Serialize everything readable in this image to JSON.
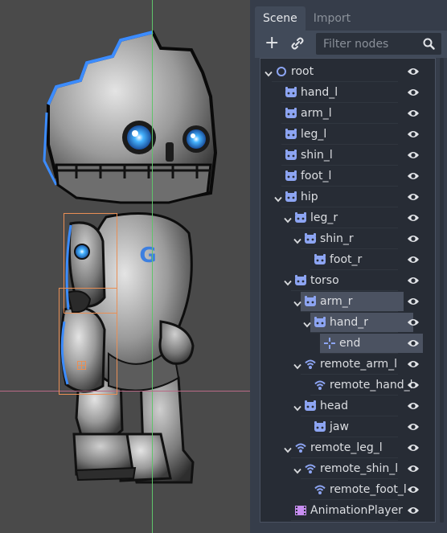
{
  "dock": {
    "tabs": [
      {
        "label": "Scene",
        "active": true
      },
      {
        "label": "Import",
        "active": false
      }
    ],
    "toolbar": {
      "add_icon": "plus-icon",
      "link_icon": "link-icon",
      "filter_placeholder": "Filter nodes",
      "search_icon": "search-icon"
    }
  },
  "colors": {
    "accent": "#8da5f3",
    "bone_outline": "#e98f55",
    "axis_vertical": "#5fc46a",
    "axis_horizontal": "#b86a86",
    "selection": "#4b5261"
  },
  "scene_tree": [
    {
      "label": "root",
      "depth": 0,
      "icon": "node2d-circle-icon",
      "arrow": "open",
      "selected": false
    },
    {
      "label": "hand_l",
      "depth": 1,
      "icon": "bone-icon",
      "arrow": "none",
      "selected": false
    },
    {
      "label": "arm_l",
      "depth": 1,
      "icon": "bone-icon",
      "arrow": "none",
      "selected": false
    },
    {
      "label": "leg_l",
      "depth": 1,
      "icon": "bone-icon",
      "arrow": "none",
      "selected": false
    },
    {
      "label": "shin_l",
      "depth": 1,
      "icon": "bone-icon",
      "arrow": "none",
      "selected": false
    },
    {
      "label": "foot_l",
      "depth": 1,
      "icon": "bone-icon",
      "arrow": "none",
      "selected": false
    },
    {
      "label": "hip",
      "depth": 1,
      "icon": "bone-icon",
      "arrow": "open",
      "selected": false
    },
    {
      "label": "leg_r",
      "depth": 2,
      "icon": "bone-icon",
      "arrow": "open",
      "selected": false
    },
    {
      "label": "shin_r",
      "depth": 3,
      "icon": "bone-icon",
      "arrow": "open",
      "selected": false
    },
    {
      "label": "foot_r",
      "depth": 4,
      "icon": "bone-icon",
      "arrow": "none",
      "selected": false
    },
    {
      "label": "torso",
      "depth": 2,
      "icon": "bone-icon",
      "arrow": "open",
      "selected": false
    },
    {
      "label": "arm_r",
      "depth": 3,
      "icon": "bone-icon",
      "arrow": "open",
      "selected": true
    },
    {
      "label": "hand_r",
      "depth": 4,
      "icon": "bone-icon",
      "arrow": "open",
      "selected": true
    },
    {
      "label": "end",
      "depth": 5,
      "icon": "position-icon",
      "arrow": "none",
      "selected": true
    },
    {
      "label": "remote_arm_l",
      "depth": 3,
      "icon": "remote-transform-icon",
      "arrow": "open",
      "selected": false
    },
    {
      "label": "remote_hand_l",
      "depth": 4,
      "icon": "remote-transform-icon",
      "arrow": "none",
      "selected": false
    },
    {
      "label": "head",
      "depth": 3,
      "icon": "bone-icon",
      "arrow": "open",
      "selected": false
    },
    {
      "label": "jaw",
      "depth": 4,
      "icon": "bone-icon",
      "arrow": "none",
      "selected": false
    },
    {
      "label": "remote_leg_l",
      "depth": 2,
      "icon": "remote-transform-icon",
      "arrow": "open",
      "selected": false
    },
    {
      "label": "remote_shin_l",
      "depth": 3,
      "icon": "remote-transform-icon",
      "arrow": "open",
      "selected": false
    },
    {
      "label": "remote_foot_l",
      "depth": 4,
      "icon": "remote-transform-icon",
      "arrow": "none",
      "selected": false
    },
    {
      "label": "AnimationPlayer",
      "depth": 2,
      "icon": "animation-player-icon",
      "arrow": "none",
      "selected": false
    }
  ],
  "visibility_icon": "eye-icon",
  "viewport": {
    "logo_letter": "G"
  }
}
